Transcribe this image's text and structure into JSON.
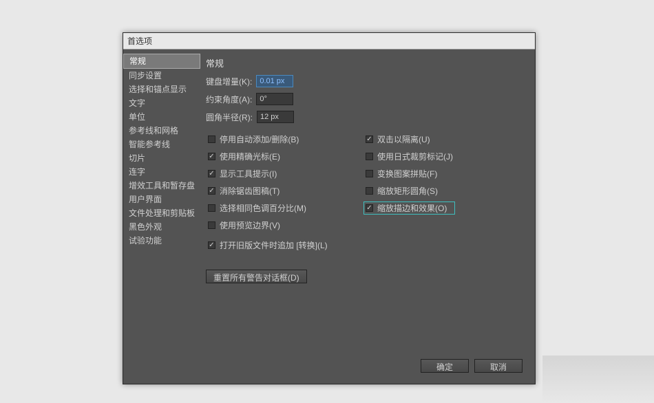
{
  "dialog": {
    "title": "首选项"
  },
  "sidebar": {
    "items": [
      "常规",
      "同步设置",
      "选择和锚点显示",
      "文字",
      "单位",
      "参考线和网格",
      "智能参考线",
      "切片",
      "连字",
      "增效工具和暂存盘",
      "用户界面",
      "文件处理和剪贴板",
      "黑色外观",
      "试验功能"
    ],
    "selectedIndex": 0
  },
  "content": {
    "heading": "常规",
    "fields": {
      "keyboardIncrement": {
        "label": "键盘增量(K):",
        "value": "0.01 px"
      },
      "constrainAngle": {
        "label": "约束角度(A):",
        "value": "0°"
      },
      "cornerRadius": {
        "label": "圆角半径(R):",
        "value": "12 px"
      }
    },
    "checkboxesLeft": [
      {
        "label": "停用自动添加/删除(B)",
        "checked": false
      },
      {
        "label": "使用精确光标(E)",
        "checked": true
      },
      {
        "label": "显示工具提示(I)",
        "checked": true
      },
      {
        "label": "消除锯齿图稿(T)",
        "checked": true
      },
      {
        "label": "选择相同色调百分比(M)",
        "checked": false
      },
      {
        "label": "使用预览边界(V)",
        "checked": false
      }
    ],
    "checkboxesRight": [
      {
        "label": "双击以隔离(U)",
        "checked": true
      },
      {
        "label": "使用日式裁剪标记(J)",
        "checked": false
      },
      {
        "label": "变换图案拼贴(F)",
        "checked": false
      },
      {
        "label": "缩放矩形圆角(S)",
        "checked": false
      },
      {
        "label": "缩放描边和效果(O)",
        "checked": true,
        "highlight": true
      }
    ],
    "appendOnOpen": {
      "label": "打开旧版文件时追加 [转换](L)",
      "checked": true
    },
    "resetButton": "重置所有警告对话框(D)"
  },
  "buttons": {
    "ok": "确定",
    "cancel": "取消"
  }
}
